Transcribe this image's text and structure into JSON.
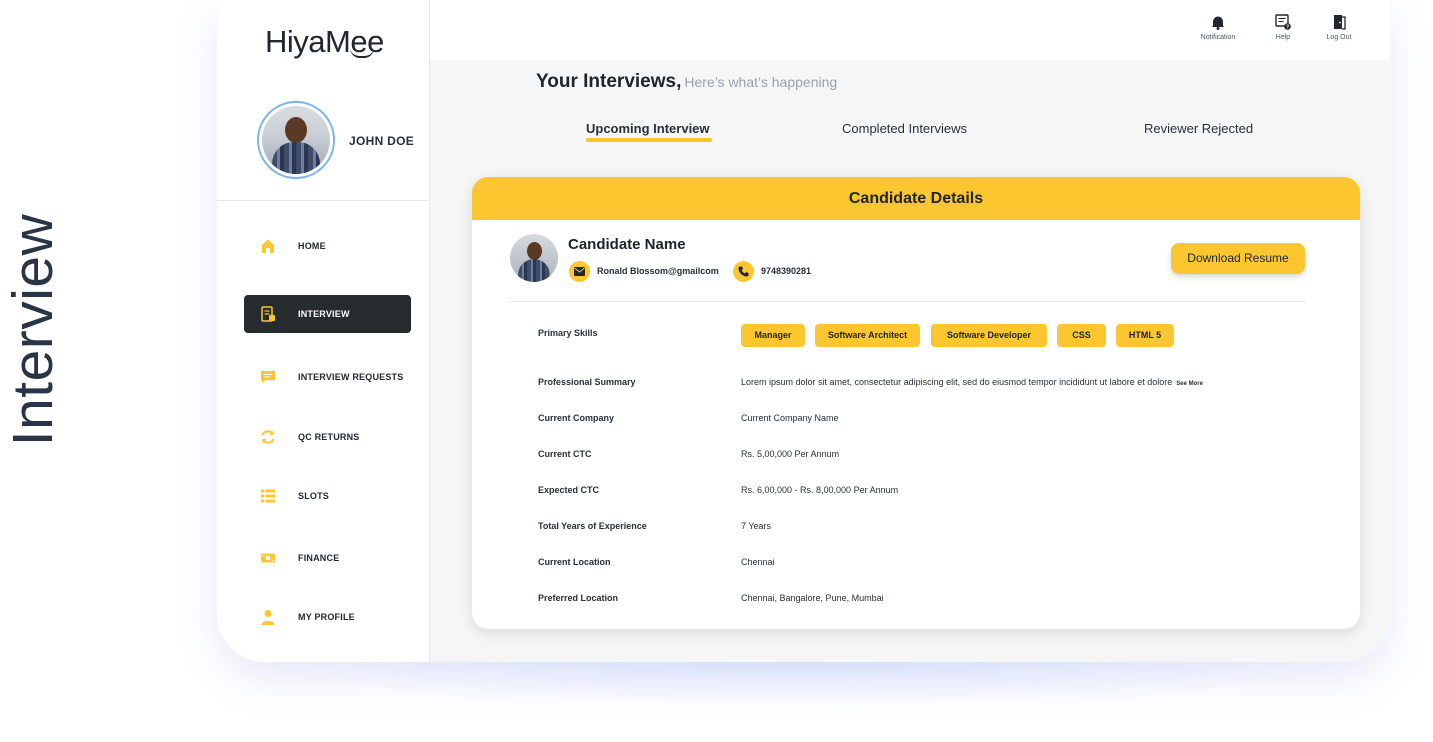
{
  "page": {
    "side_title": "Interview"
  },
  "brand": {
    "logo_text": "HiyaMee"
  },
  "user": {
    "name": "JOHN DOE"
  },
  "sidebar": {
    "items": [
      {
        "label": "HOME",
        "icon": "home-icon",
        "active": false
      },
      {
        "label": "INTERVIEW",
        "icon": "interview-icon",
        "active": true
      },
      {
        "label": "INTERVIEW REQUESTS",
        "icon": "message-icon",
        "active": false
      },
      {
        "label": "QC RETURNS",
        "icon": "refresh-icon",
        "active": false
      },
      {
        "label": "SLOTS",
        "icon": "list-icon",
        "active": false
      },
      {
        "label": "FINANCE",
        "icon": "money-icon",
        "active": false
      },
      {
        "label": "MY PROFILE",
        "icon": "user-icon",
        "active": false
      }
    ]
  },
  "topbar": {
    "notification_label": "Notification",
    "help_label": "Help",
    "logout_label": "Log Out"
  },
  "main": {
    "title": "Your Interviews,",
    "subtitle": "Here’s what’s happening",
    "tabs": [
      {
        "label": "Upcoming Interview",
        "active": true
      },
      {
        "label": "Completed Interviews",
        "active": false
      },
      {
        "label": "Reviewer Rejected",
        "active": false
      }
    ]
  },
  "candidate": {
    "card_title": "Candidate Details",
    "name": "Candidate Name",
    "email": "Ronald Blossom@gmailcom",
    "phone": "9748390281",
    "download_label": "Download Resume",
    "skills_label": "Primary Skills",
    "skills": [
      "Manager",
      "Software Architect",
      "Software Developer",
      "CSS",
      "HTML 5"
    ],
    "details": [
      {
        "label": "Professional Summary",
        "value": "Lorem ipsum dolor sit amet, consectetur adipiscing elit, sed do eiusmod tempor incididunt ut labore et dolore",
        "more": "See More"
      },
      {
        "label": "Current Company",
        "value": "Current Company Name"
      },
      {
        "label": "Current CTC",
        "value": "Rs. 5,00,000 Per Annum"
      },
      {
        "label": "Expected CTC",
        "value": "Rs. 6,00,000 - Rs. 8,00,000 Per Annum"
      },
      {
        "label": "Total Years of Experience",
        "value": "7 Years"
      },
      {
        "label": "Current Location",
        "value": "Chennai"
      },
      {
        "label": "Preferred Location",
        "value": "Chennai, Bangalore, Pune, Mumbai"
      }
    ]
  },
  "colors": {
    "accent": "#fbc62f",
    "active_nav": "#262b2e",
    "text": "#20252c"
  }
}
